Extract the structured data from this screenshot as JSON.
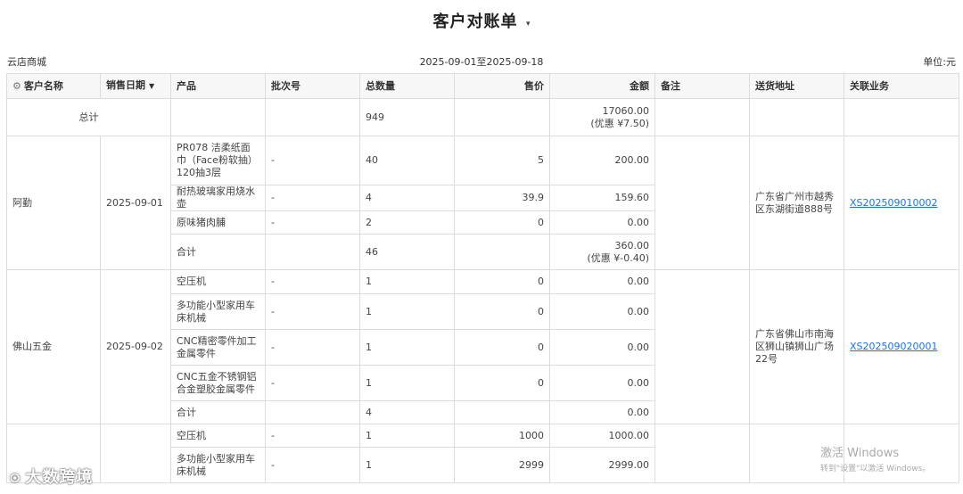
{
  "header": {
    "title": "客户对账单",
    "title_caret": "▾"
  },
  "meta": {
    "shop": "云店商城",
    "period": "2025-09-01至2025-09-18",
    "unit": "单位:元"
  },
  "columns": {
    "customer": "客户名称",
    "date": "销售日期",
    "product": "产品",
    "batch": "批次号",
    "qty": "总数量",
    "price": "售价",
    "amount": "金额",
    "note": "备注",
    "address": "送货地址",
    "related": "关联业务"
  },
  "icons": {
    "settings": "gear-icon",
    "sort": "caret-down-icon"
  },
  "total": {
    "label": "总计",
    "qty": "949",
    "amount": "17060.00",
    "discount": "(优惠 ¥7.50)"
  },
  "groups": [
    {
      "customer": "阿勤",
      "date": "2025-09-01",
      "address": "广东省广州市越秀区东湖街道888号",
      "related": "XS202509010002",
      "items": [
        {
          "product": "PR078 洁柔纸面巾（Face粉软抽）120抽3层",
          "batch": "-",
          "qty": "40",
          "price": "5",
          "amount": "200.00"
        },
        {
          "product": "耐热玻璃家用烧水壶",
          "batch": "-",
          "qty": "4",
          "price": "39.9",
          "amount": "159.60"
        },
        {
          "product": "原味猪肉脯",
          "batch": "-",
          "qty": "2",
          "price": "0",
          "amount": "0.00"
        }
      ],
      "subtotal": {
        "label": "合计",
        "qty": "46",
        "amount": "360.00",
        "discount": "(优惠 ¥-0.40)"
      }
    },
    {
      "customer": "佛山五金",
      "date": "2025-09-02",
      "address": "广东省佛山市南海区狮山镇狮山广场22号",
      "related": "XS202509020001",
      "items": [
        {
          "product": "空压机",
          "batch": "-",
          "qty": "1",
          "price": "0",
          "amount": "0.00"
        },
        {
          "product": "多功能小型家用车床机械",
          "batch": "-",
          "qty": "1",
          "price": "0",
          "amount": "0.00"
        },
        {
          "product": "CNC精密零件加工金属零件",
          "batch": "-",
          "qty": "1",
          "price": "0",
          "amount": "0.00"
        },
        {
          "product": "CNC五金不锈钢铝合金塑胶金属零件",
          "batch": "-",
          "qty": "1",
          "price": "0",
          "amount": "0.00"
        }
      ],
      "subtotal": {
        "label": "合计",
        "qty": "4",
        "amount": "0.00"
      }
    },
    {
      "items": [
        {
          "product": "空压机",
          "batch": "-",
          "qty": "1",
          "price": "1000",
          "amount": "1000.00"
        },
        {
          "product": "多功能小型家用车床机械",
          "batch": "-",
          "qty": "1",
          "price": "2999",
          "amount": "2999.00"
        }
      ]
    }
  ],
  "watermark": {
    "line1": "激活 Windows",
    "line2": "转到\"设置\"以激活 Windows。"
  },
  "logo": {
    "text": "大数跨境"
  }
}
